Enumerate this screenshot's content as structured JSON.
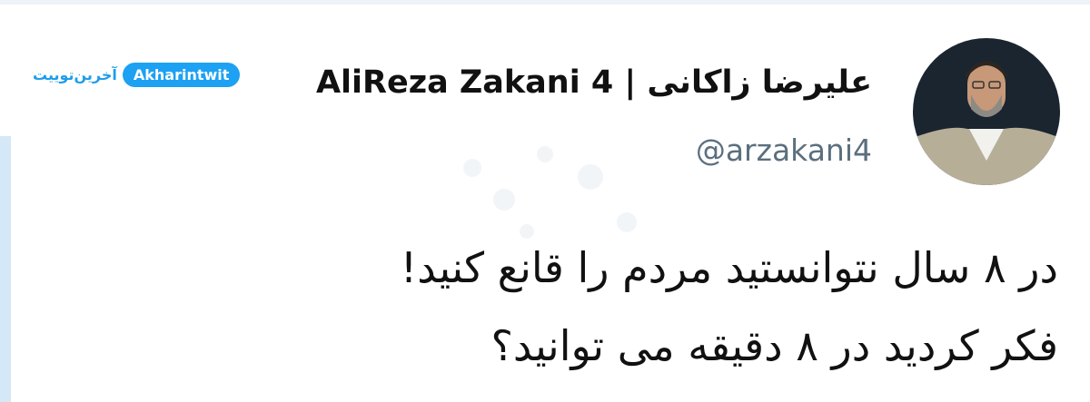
{
  "author": {
    "display_name": "AliReza Zakani 4 | علیرضا زاکانی",
    "handle": "@arzakani4"
  },
  "badge": {
    "persian_label": "آخرین‌توییت",
    "english_label": "Akharintwit",
    "color": "#1da1f2"
  },
  "tweet": {
    "lines": [
      "در ۸ سال نتوانستید مردم را قانع کنید!",
      "فکر کردید در ۸ دقیقه می توانید؟"
    ]
  },
  "colors": {
    "text": "#111111",
    "handle": "#5b6f7e",
    "accent_bar": "#d4e8f7"
  }
}
